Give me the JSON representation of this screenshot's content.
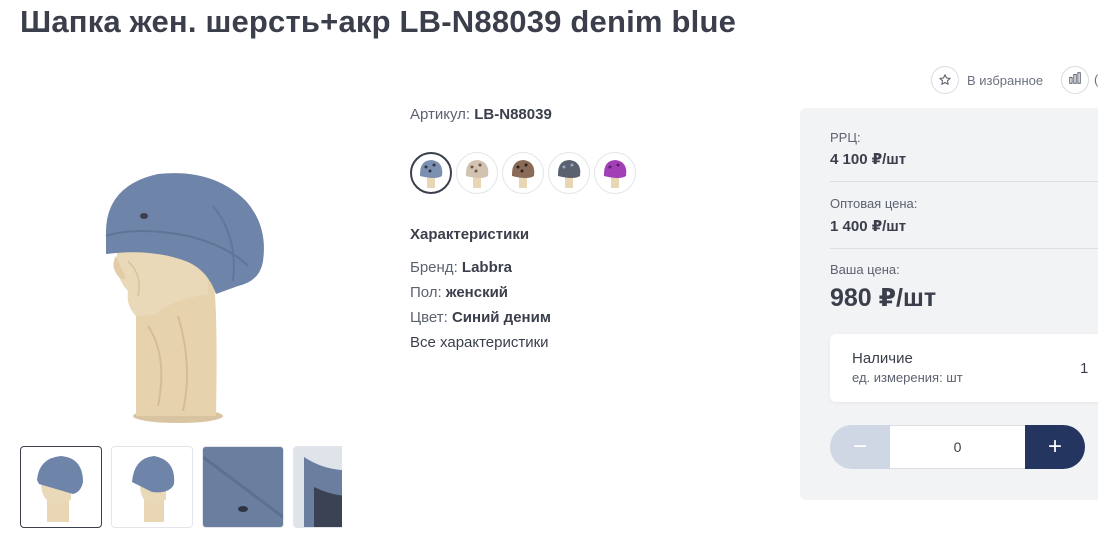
{
  "product": {
    "title": "Шапка жен. шерсть+акр LB-N88039 denim blue",
    "sku_label": "Артикул:",
    "sku_value": "LB-N88039"
  },
  "actions": {
    "favorite_label": "В избранное",
    "compare_label_visible": "("
  },
  "characteristics": {
    "title": "Характеристики",
    "rows": [
      {
        "label": "Бренд:",
        "value": "Labbra"
      },
      {
        "label": "Пол:",
        "value": "женский"
      },
      {
        "label": "Цвет:",
        "value": "Синий деним"
      }
    ],
    "all_link": "Все характеристики"
  },
  "swatches": [
    {
      "name": "denim-blue-leopard",
      "color": "#7b8fb0",
      "active": true
    },
    {
      "name": "beige-leopard",
      "color": "#d2c2b0",
      "active": false
    },
    {
      "name": "brown-leopard",
      "color": "#8a6b57",
      "active": false
    },
    {
      "name": "grey-blue",
      "color": "#5a6270",
      "active": false
    },
    {
      "name": "purple",
      "color": "#a23fb7",
      "active": false
    }
  ],
  "pricing": {
    "rrp_label": "РРЦ:",
    "rrp_value": "4 100 ₽/шт",
    "wholesale_label": "Оптовая цена:",
    "wholesale_value": "1 400 ₽/шт",
    "your_price_label": "Ваша цена:",
    "your_price_value": "980 ₽/шт"
  },
  "stock": {
    "label": "Наличие",
    "unit_label": "ед. измерения: шт",
    "count": "1"
  },
  "stepper": {
    "minus_label": "−",
    "value": "0",
    "plus_label": "+"
  },
  "colors": {
    "text": "#3a3f4b",
    "panel_bg": "#f2f3f5",
    "plus_button": "#243560",
    "minus_button": "#cfd6e4",
    "hat": "#6e84a8",
    "wood": "#e8d6b4"
  }
}
